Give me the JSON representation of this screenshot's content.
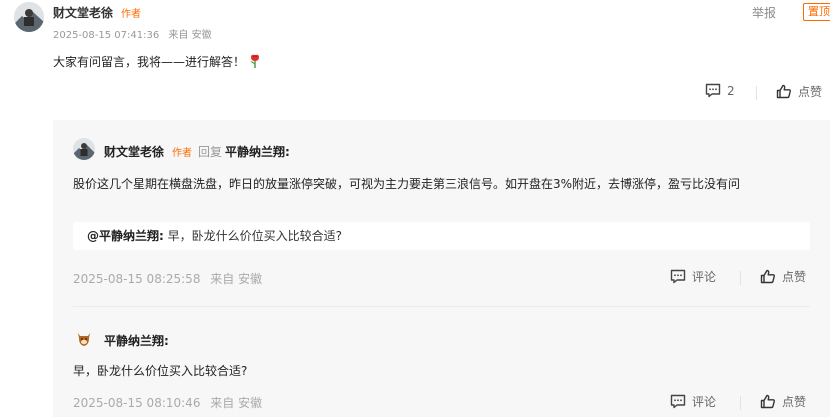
{
  "comment": {
    "author_name": "财文堂老徐",
    "author_tag": "作者",
    "time": "2025-08-15 07:41:36",
    "location": "来自 安徽",
    "report_label": "举报",
    "pin_label": "置顶",
    "text": "大家有问留言，我将——进行解答！",
    "reply_count": "2",
    "like_label": "点赞"
  },
  "replies": [
    {
      "author_name": "财文堂老徐",
      "author_tag": "作者",
      "reply_word": "回复",
      "target_name": "平静纳兰翔:",
      "text": "股价这几个星期在横盘洗盘，昨日的放量涨停突破，可视为主力要走第三浪信号。如开盘在3%附近，去博涨停，盈亏比没有问",
      "quote_name": "@平静纳兰翔:",
      "quote_text": "早，卧龙什么价位买入比较合适?",
      "time": "2025-08-15 08:25:58",
      "location": "来自 安徽",
      "comment_label": "评论",
      "like_label": "点赞"
    },
    {
      "author_name": "平静纳兰翔:",
      "text": "早，卧龙什么价位买入比较合适?",
      "time": "2025-08-15 08:10:46",
      "location": "来自 安徽",
      "comment_label": "评论",
      "like_label": "点赞"
    }
  ],
  "colors": {
    "accent_orange": "#ff6a00",
    "meta_gray": "#999999",
    "panel_bg": "#f7f7f7"
  },
  "icons": [
    "comment-icon",
    "thumbs-up-icon",
    "rose-icon"
  ]
}
